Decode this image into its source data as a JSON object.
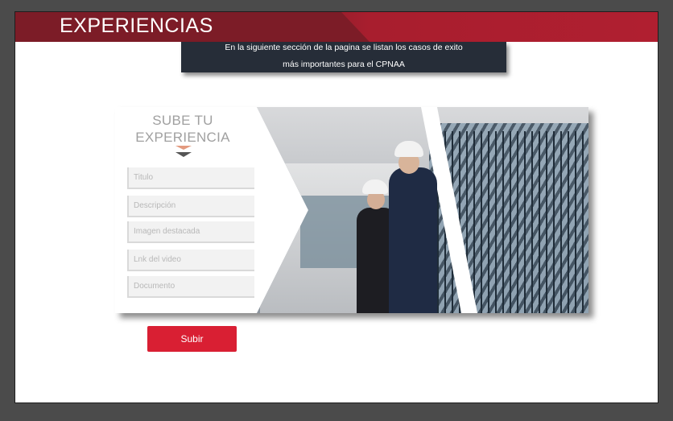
{
  "header": {
    "title": "EXPERIENCIAS"
  },
  "info": {
    "line1": "En la siguiente sección de la pagina se listan los casos de exito",
    "line2": "más importantes para el CPNAA"
  },
  "form": {
    "title_line1": "SUBE TU",
    "title_line2": "EXPERIENCIA",
    "fields": [
      {
        "placeholder": "Titulo"
      },
      {
        "placeholder": "Descripción"
      },
      {
        "placeholder": "Imagen destacada"
      },
      {
        "placeholder": "Lnk del video"
      },
      {
        "placeholder": "Documento"
      }
    ],
    "submit_label": "Subir"
  },
  "colors": {
    "header_dark": "#7c1c27",
    "header_red": "#b01f30",
    "info_bg": "#262d38",
    "button": "#d91f33"
  }
}
